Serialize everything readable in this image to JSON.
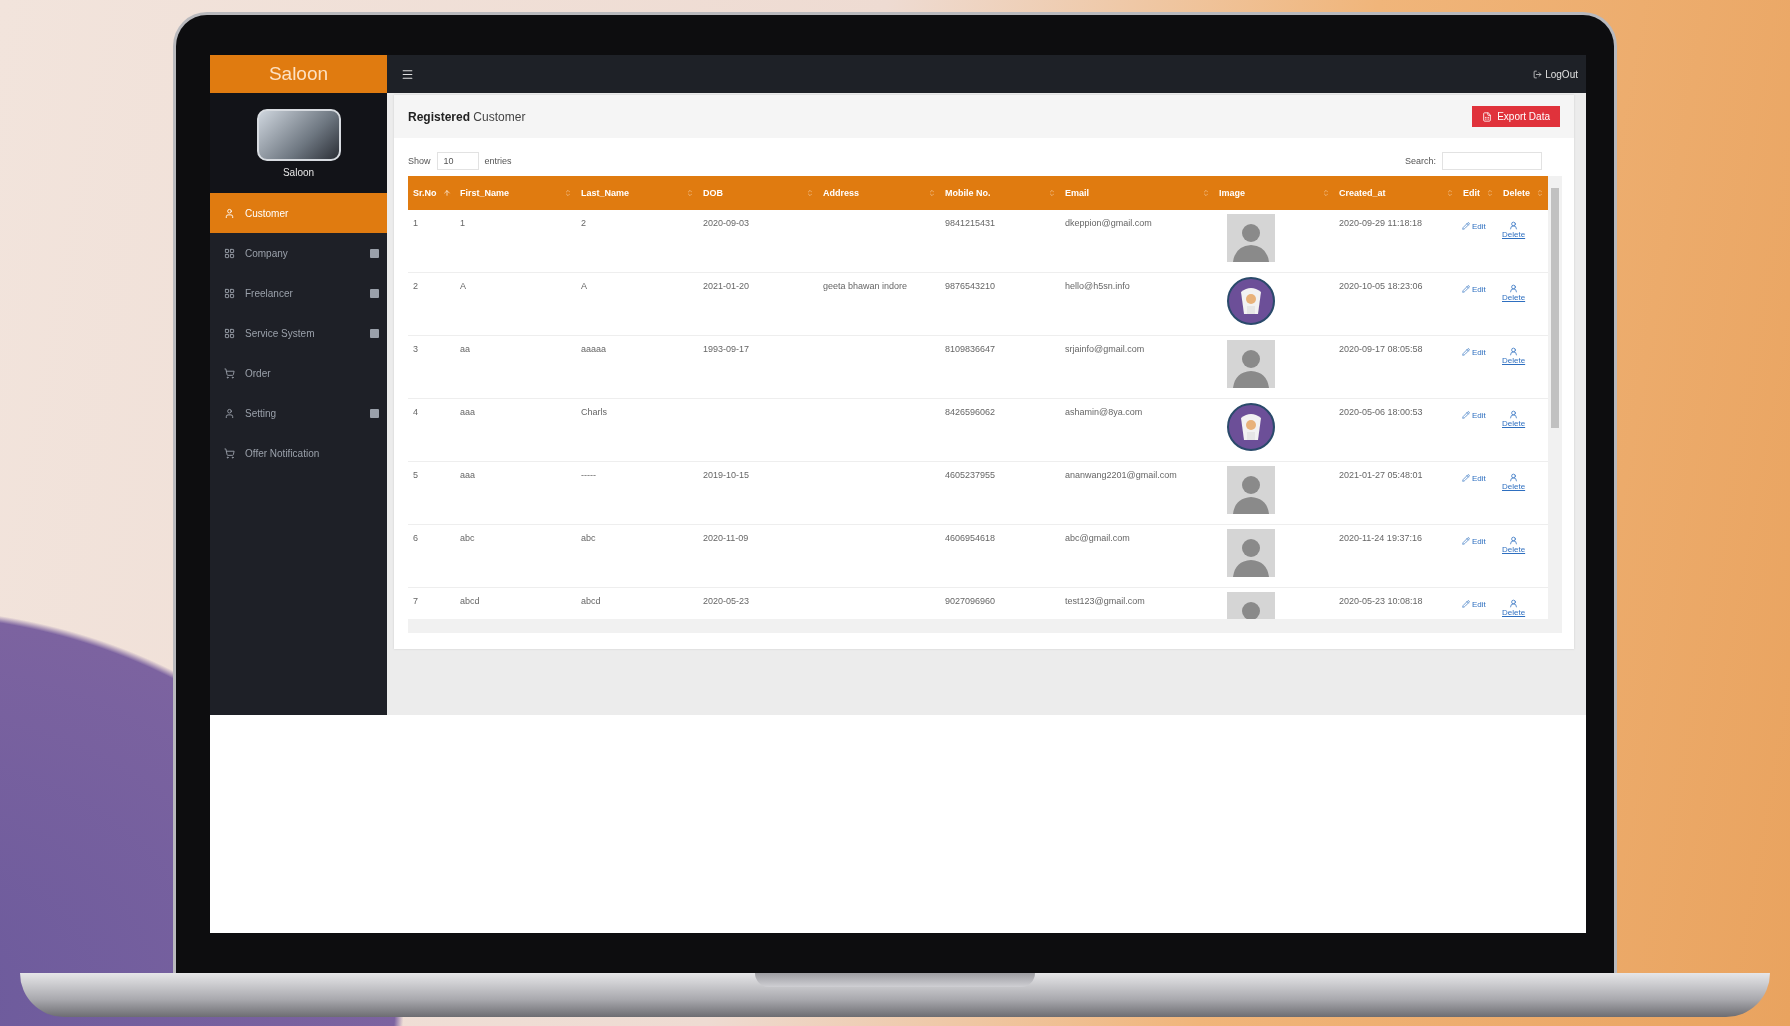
{
  "sidebar": {
    "brand": "Saloon",
    "profile_caption": "Saloon",
    "items": [
      {
        "label": "Customer",
        "kind": "user",
        "selected": true,
        "expandable": false
      },
      {
        "label": "Company",
        "kind": "grid",
        "selected": false,
        "expandable": true
      },
      {
        "label": "Freelancer",
        "kind": "grid",
        "selected": false,
        "expandable": true
      },
      {
        "label": "Service System",
        "kind": "grid",
        "selected": false,
        "expandable": true
      },
      {
        "label": "Order",
        "kind": "cart",
        "selected": false,
        "expandable": false
      },
      {
        "label": "Setting",
        "kind": "user",
        "selected": false,
        "expandable": true
      },
      {
        "label": "Offer Notification",
        "kind": "cart",
        "selected": false,
        "expandable": false
      }
    ]
  },
  "top_bar": {
    "logout": "LogOut"
  },
  "panel": {
    "title": "**Registered** Customer",
    "export_button": "Export Data",
    "length_control": {
      "prefix": "Show",
      "value": "10",
      "suffix": "entries"
    },
    "search": {
      "label": "Search:"
    },
    "table": {
      "columns": [
        {
          "label": "Sr.No",
          "sorted": true
        },
        {
          "label": "First_Name",
          "sorted": false
        },
        {
          "label": "Last_Name",
          "sorted": false
        },
        {
          "label": "DOB",
          "sorted": false
        },
        {
          "label": "Address",
          "sorted": false
        },
        {
          "label": "Mobile No.",
          "sorted": false
        },
        {
          "label": "Email",
          "sorted": false
        },
        {
          "label": "Image",
          "sorted": false
        },
        {
          "label": "Created_at",
          "sorted": false
        },
        {
          "label": "Edit",
          "sorted": false
        },
        {
          "label": "Delete",
          "sorted": false
        }
      ],
      "rows": [
        {
          "sr": "1",
          "first_name": "1",
          "last_name": "2",
          "dob": "2020-09-03",
          "mobile": "9841215431",
          "email": "dkeppion@gmail.com",
          "kind": "silhouette",
          "created_at": "2020-09-29 11:18:18",
          "edit": "Edit",
          "delete": "Delete"
        },
        {
          "sr": "2",
          "first_name": "A",
          "last_name": "A",
          "dob": "2021-01-20",
          "address": "geeta bhawan indore",
          "mobile": "9876543210",
          "email": "hello@h5sn.info",
          "kind": "cartoon",
          "created_at": "2020-10-05 18:23:06",
          "edit": "Edit",
          "delete": "Delete"
        },
        {
          "sr": "3",
          "first_name": "aa",
          "last_name": "aaaaa",
          "dob": "1993-09-17",
          "mobile": "8109836647",
          "email": "srjainfo@gmail.com",
          "kind": "silhouette",
          "created_at": "2020-09-17 08:05:58",
          "edit": "Edit",
          "delete": "Delete"
        },
        {
          "sr": "4",
          "first_name": "aaa",
          "last_name": "Charls",
          "mobile": "8426596062",
          "email": "ashamin@8ya.com",
          "kind": "cartoon",
          "created_at": "2020-05-06 18:00:53",
          "edit": "Edit",
          "delete": "Delete"
        },
        {
          "sr": "5",
          "first_name": "aaa",
          "last_name": "-----",
          "dob": "2019-10-15",
          "mobile": "4605237955",
          "email": "ananwang2201@gmail.com",
          "kind": "silhouette",
          "created_at": "2021-01-27 05:48:01",
          "edit": "Edit",
          "delete": "Delete"
        },
        {
          "sr": "6",
          "first_name": "abc",
          "last_name": "abc",
          "dob": "2020-11-09",
          "mobile": "4606954618",
          "email": "abc@gmail.com",
          "kind": "silhouette",
          "created_at": "2020-11-24 19:37:16",
          "edit": "Edit",
          "delete": "Delete"
        },
        {
          "sr": "7",
          "first_name": "abcd",
          "last_name": "abcd",
          "dob": "2020-05-23",
          "mobile": "9027096960",
          "email": "test123@gmail.com",
          "kind": "silhouette",
          "created_at": "2020-05-23 10:08:18",
          "edit": "Edit",
          "delete": "Delete"
        }
      ]
    }
  }
}
